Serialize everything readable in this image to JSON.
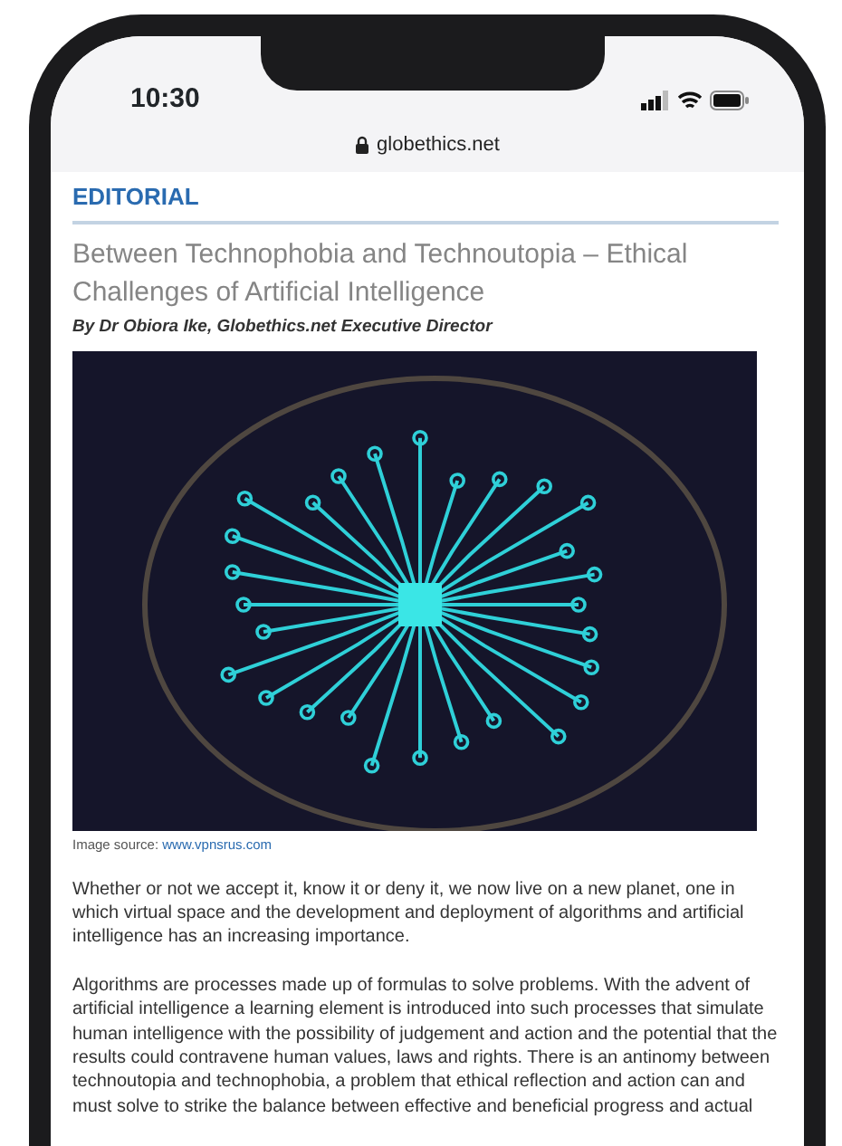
{
  "status_bar": {
    "time": "10:30"
  },
  "browser": {
    "url": "globethics.net"
  },
  "section": "EDITORIAL",
  "article": {
    "title": "Between Technophobia and Technoutopia – Ethical Challenges of Artificial Intelligence",
    "byline": "By Dr Obiora Ike, Globethics.net Executive Director",
    "image_caption": {
      "label": "Image source:",
      "link": "www.vpnsrus.com"
    },
    "paragraphs": [
      "Whether or not we accept it, know it or deny it, we now live on a new planet, one in which virtual space and the development and deployment of algorithms and artificial intelligence has an increasing importance.",
      "Algorithms are processes made up of formulas to solve problems. With the advent of artificial intelligence a learning element is introduced into such processes that simulate human intelligence with the possibility of judgement and action and the potential that the results could contravene human values, laws and rights. There is an antinomy between technoutopia and technophobia, a problem that ethical reflection and action can and must solve to strike the balance between effective and beneficial progress and actual"
    ]
  }
}
